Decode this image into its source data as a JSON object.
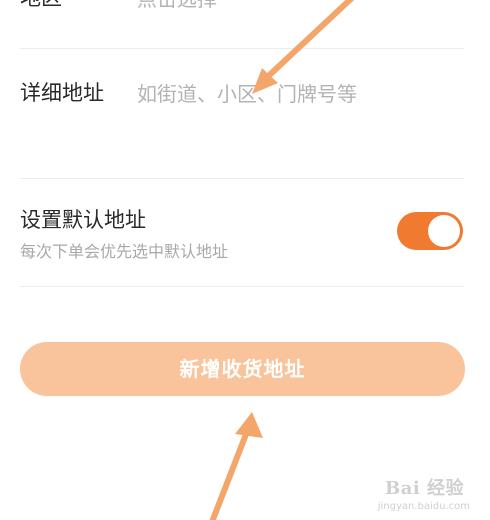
{
  "form": {
    "region": {
      "label": "地区",
      "value": "点击选择"
    },
    "detail": {
      "label": "详细地址",
      "placeholder": "如街道、小区、门牌号等"
    },
    "default_address": {
      "title": "设置默认地址",
      "subtitle": "每次下单会优先选中默认地址",
      "enabled": true
    },
    "submit_label": "新增收货地址"
  },
  "colors": {
    "accent": "#f07a30",
    "button_fill": "#f9c49b",
    "annotation_arrow": "#f4a66a"
  },
  "watermark": {
    "text": "Bai 经验",
    "sub": "jingyan.baidu.com"
  }
}
